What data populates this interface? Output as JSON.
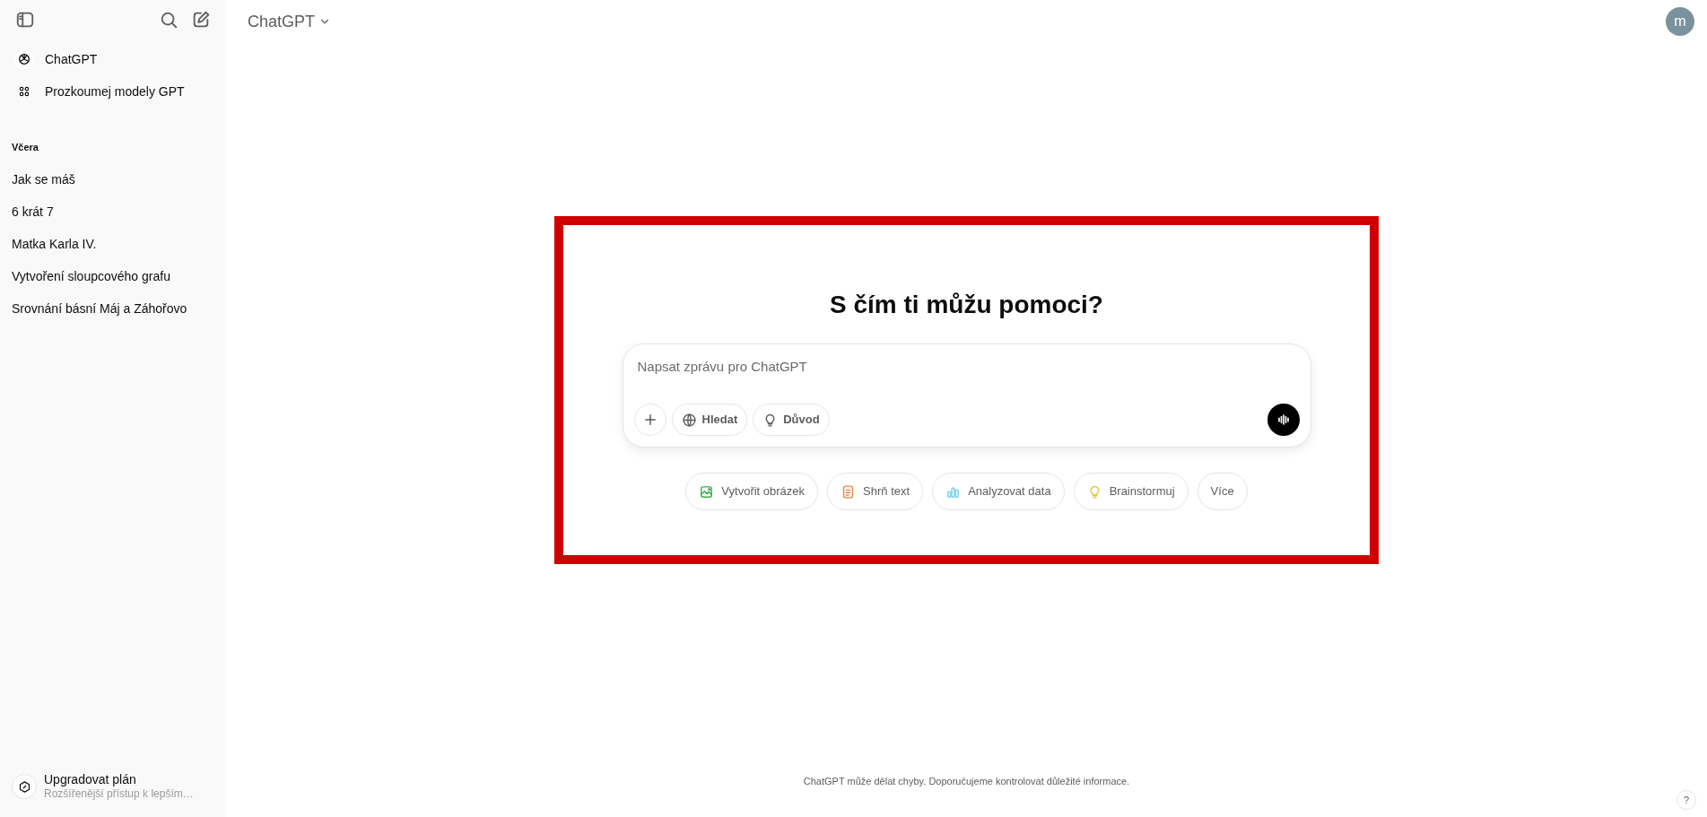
{
  "header": {
    "model": "ChatGPT",
    "avatar": "m"
  },
  "sidebar": {
    "nav": [
      {
        "kind": "logo",
        "label": "ChatGPT"
      },
      {
        "kind": "grid",
        "label": "Prozkoumej modely GPT"
      }
    ],
    "section": "Včera",
    "history": [
      "Jak se máš",
      "6 krát 7",
      "Matka Karla IV.",
      "Vytvoření sloupcového grafu",
      "Srovnání básní Máj a Záhořovo"
    ],
    "upgrade": {
      "title": "Upgradovat plán",
      "subtitle": "Rozšířenější přístup k lepším…"
    }
  },
  "hero": {
    "highlighted": true,
    "heading": "S čím ti můžu pomoci?",
    "composer": {
      "placeholder": "Napsat zprávu pro ChatGPT",
      "tools": [
        {
          "kind": "plus"
        },
        {
          "kind": "globe",
          "label": "Hledat"
        },
        {
          "kind": "bulb",
          "label": "Důvod"
        }
      ]
    },
    "suggestions": [
      {
        "kind": "image",
        "label": "Vytvořit obrázek",
        "color": "#35ae47"
      },
      {
        "kind": "doc",
        "label": "Shrň text",
        "color": "#ea8444"
      },
      {
        "kind": "chart",
        "label": "Analyzovat data",
        "color": "#76d0eb"
      },
      {
        "kind": "bulb",
        "label": "Brainstormuj",
        "color": "#e2c541"
      },
      {
        "label": "Více"
      }
    ]
  },
  "footer": {
    "disclaimer": "ChatGPT může dělat chyby. Doporučujeme kontrolovat důležité informace.",
    "help": "?"
  }
}
